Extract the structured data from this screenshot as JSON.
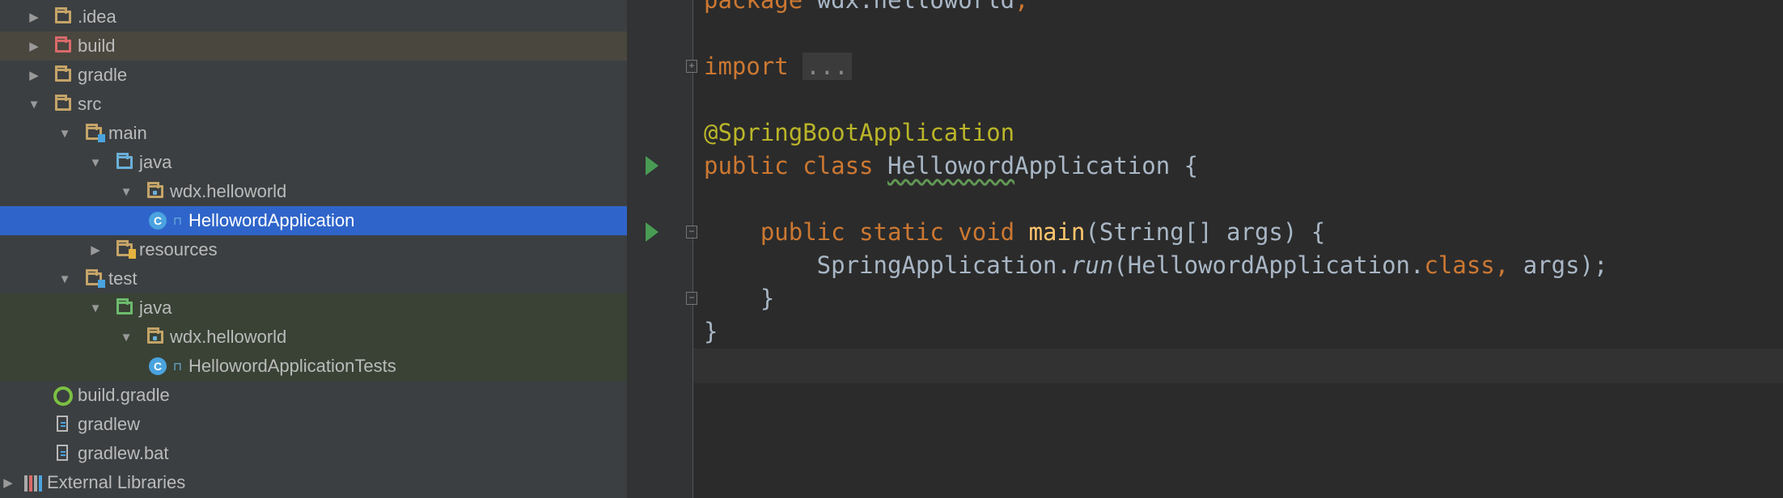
{
  "project_tree": [
    {
      "label": ".idea",
      "depth": 0,
      "arrow": "collapsed",
      "icon": "folder"
    },
    {
      "label": "build",
      "depth": 0,
      "arrow": "collapsed",
      "icon": "folder-excluded",
      "highlight": "build"
    },
    {
      "label": "gradle",
      "depth": 0,
      "arrow": "collapsed",
      "icon": "folder"
    },
    {
      "label": "src",
      "depth": 0,
      "arrow": "expanded",
      "icon": "folder"
    },
    {
      "label": "main",
      "depth": 1,
      "arrow": "expanded",
      "icon": "folder-module"
    },
    {
      "label": "java",
      "depth": 2,
      "arrow": "expanded",
      "icon": "folder-source"
    },
    {
      "label": "wdx.helloworld",
      "depth": 3,
      "arrow": "expanded",
      "icon": "package"
    },
    {
      "label": "HellowordApplication",
      "depth": 4,
      "arrow": "none",
      "icon": "class",
      "selected": true
    },
    {
      "label": "resources",
      "depth": 2,
      "arrow": "collapsed",
      "icon": "folder-resources"
    },
    {
      "label": "test",
      "depth": 1,
      "arrow": "expanded",
      "icon": "folder-module"
    },
    {
      "label": "java",
      "depth": 2,
      "arrow": "expanded",
      "icon": "folder-test",
      "highlight": "test"
    },
    {
      "label": "wdx.helloworld",
      "depth": 3,
      "arrow": "expanded",
      "icon": "package",
      "highlight": "test"
    },
    {
      "label": "HellowordApplicationTests",
      "depth": 4,
      "arrow": "none",
      "icon": "class",
      "highlight": "test"
    },
    {
      "label": "build.gradle",
      "depth": 0,
      "arrow": "none",
      "icon": "gradle-file",
      "indent_extra": true
    },
    {
      "label": "gradlew",
      "depth": 0,
      "arrow": "none",
      "icon": "text-file",
      "indent_extra": true
    },
    {
      "label": "gradlew.bat",
      "depth": 0,
      "arrow": "none",
      "icon": "text-file",
      "indent_extra": true
    },
    {
      "label": "External Libraries",
      "depth": -1,
      "arrow": "collapsed",
      "icon": "libraries"
    }
  ],
  "code_lines": [
    [
      {
        "t": "package ",
        "c": "kw"
      },
      {
        "t": "wdx.helloworld"
      },
      {
        "t": ";",
        "c": "kw"
      }
    ],
    [],
    [
      {
        "t": "import ",
        "c": "kw"
      },
      {
        "t": "...",
        "c": "fold"
      }
    ],
    [],
    [
      {
        "t": "@SpringBootApplication",
        "c": "ann"
      }
    ],
    [
      {
        "t": "public ",
        "c": "kw"
      },
      {
        "t": "class ",
        "c": "kw"
      },
      {
        "t": "Helloword",
        "c": "squig"
      },
      {
        "t": "Application {"
      }
    ],
    [],
    [
      {
        "t": "    "
      },
      {
        "t": "public ",
        "c": "kw"
      },
      {
        "t": "static ",
        "c": "kw"
      },
      {
        "t": "void ",
        "c": "kw"
      },
      {
        "t": "main",
        "c": "fn"
      },
      {
        "t": "(String[] args) {"
      }
    ],
    [
      {
        "t": "        SpringApplication."
      },
      {
        "t": "run",
        "c": "it"
      },
      {
        "t": "(HellowordApplication."
      },
      {
        "t": "class",
        "c": "kw"
      },
      {
        "t": ", ",
        "c": "kw"
      },
      {
        "t": "args);"
      }
    ],
    [
      {
        "t": "    }"
      }
    ],
    [
      {
        "t": "}"
      }
    ],
    []
  ],
  "gutter": {
    "run_lines": [
      5,
      7
    ],
    "fold_start_lines": [
      2,
      7
    ],
    "fold_end_lines": [
      9
    ]
  },
  "colors": {
    "selection": "#2f65ca",
    "keyword": "#cc7832",
    "annotation": "#bbb529",
    "run": "#499c54"
  }
}
